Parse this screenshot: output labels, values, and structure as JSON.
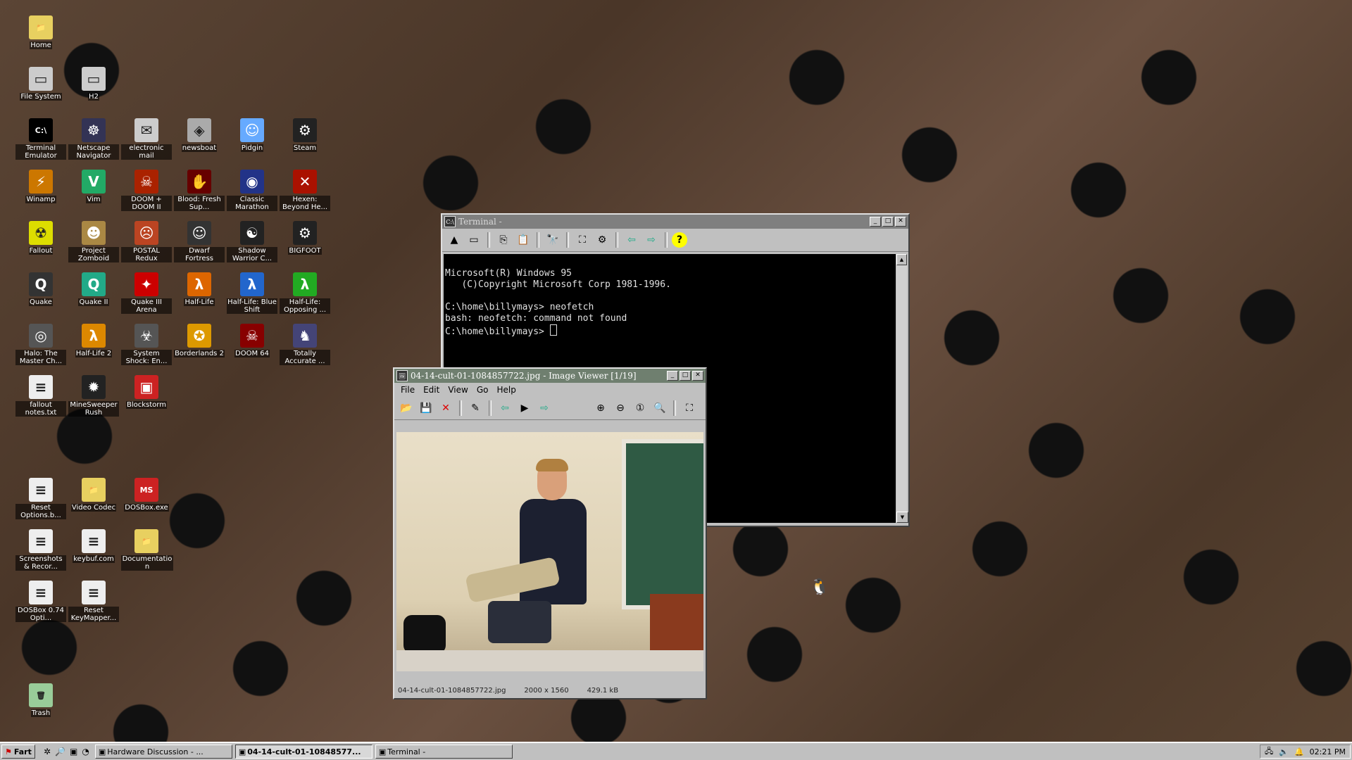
{
  "colors": {
    "accent": "#6f7f6f",
    "terminal_bg": "#000000",
    "window_gray": "#c0c0c0"
  },
  "desktop_icons": [
    {
      "label": "Home",
      "icon": "folder-icon"
    },
    {
      "label": "File System",
      "icon": "drive-icon"
    },
    {
      "label": "H2",
      "icon": "drive-icon"
    },
    {
      "label": "Terminal Emulator",
      "icon": "terminal-icon"
    },
    {
      "label": "Netscape Navigator",
      "icon": "ship-wheel-icon"
    },
    {
      "label": "electronic mail",
      "icon": "mail-icon"
    },
    {
      "label": "newsboat",
      "icon": "news-icon"
    },
    {
      "label": "Pidgin",
      "icon": "pidgin-icon"
    },
    {
      "label": "Steam",
      "icon": "steam-icon"
    },
    {
      "label": "Winamp",
      "icon": "winamp-icon"
    },
    {
      "label": "Vim",
      "icon": "vim-icon"
    },
    {
      "label": "DOOM + DOOM II",
      "icon": "doom-icon"
    },
    {
      "label": "Blood: Fresh Sup...",
      "icon": "blood-icon"
    },
    {
      "label": "Classic Marathon",
      "icon": "marathon-icon"
    },
    {
      "label": "Hexen: Beyond He...",
      "icon": "hexen-icon"
    },
    {
      "label": "Fallout",
      "icon": "radiation-icon"
    },
    {
      "label": "Project Zomboid",
      "icon": "zomboid-icon"
    },
    {
      "label": "POSTAL Redux",
      "icon": "postal-icon"
    },
    {
      "label": "Dwarf Fortress",
      "icon": "dwarf-icon"
    },
    {
      "label": "Shadow Warrior C...",
      "icon": "yin-yang-icon"
    },
    {
      "label": "BIGFOOT",
      "icon": "steam-icon"
    },
    {
      "label": "Quake",
      "icon": "quake-icon"
    },
    {
      "label": "Quake II",
      "icon": "quake2-icon"
    },
    {
      "label": "Quake III Arena",
      "icon": "quake3-icon"
    },
    {
      "label": "Half-Life",
      "icon": "lambda-icon"
    },
    {
      "label": "Half-Life: Blue Shift",
      "icon": "lambda-blue-icon"
    },
    {
      "label": "Half-Life: Opposing ...",
      "icon": "lambda-green-icon"
    },
    {
      "label": "Halo: The Master Ch...",
      "icon": "halo-icon"
    },
    {
      "label": "Half-Life 2",
      "icon": "lambda2-icon"
    },
    {
      "label": "System Shock: En...",
      "icon": "shodan-icon"
    },
    {
      "label": "Borderlands 2",
      "icon": "borderlands-icon"
    },
    {
      "label": "DOOM 64",
      "icon": "doom64-icon"
    },
    {
      "label": "Totally Accurate ...",
      "icon": "tabs-icon"
    },
    {
      "label": "fallout notes.txt",
      "icon": "text-file-icon"
    },
    {
      "label": "MineSweeper Rush",
      "icon": "mine-icon"
    },
    {
      "label": "Blockstorm",
      "icon": "blockstorm-icon"
    },
    {
      "label": "Reset Options.b...",
      "icon": "text-file-icon"
    },
    {
      "label": "Video Codec",
      "icon": "folder-icon"
    },
    {
      "label": "DOSBox.exe",
      "icon": "dosbox-icon"
    },
    {
      "label": "Screenshots & Recor...",
      "icon": "text-file-icon"
    },
    {
      "label": "keybuf.com",
      "icon": "text-file-icon"
    },
    {
      "label": "Documentation",
      "icon": "folder-icon"
    },
    {
      "label": "DOSBox 0.74 Opti...",
      "icon": "text-file-icon"
    },
    {
      "label": "Reset KeyMapper...",
      "icon": "text-file-icon"
    },
    {
      "label": "Trash",
      "icon": "trash-icon"
    }
  ],
  "terminal": {
    "title": "Terminal -",
    "lines": [
      "Microsoft(R) Windows 95",
      "   (C)Copyright Microsoft Corp 1981-1996.",
      "",
      "C:\\home\\billymays> neofetch",
      "bash: neofetch: command not found",
      "C:\\home\\billymays> "
    ]
  },
  "image_viewer": {
    "title": "04-14-cult-01-1084857722.jpg - Image Viewer [1/19]",
    "menu": [
      "File",
      "Edit",
      "View",
      "Go",
      "Help"
    ],
    "status_filename": "04-14-cult-01-1084857722.jpg",
    "status_dimensions": "2000 x 1560",
    "status_size": "429.1 kB"
  },
  "taskbar": {
    "start_label": "Fart",
    "tasks": [
      {
        "label": "Hardware Discussion - ...",
        "pressed": false
      },
      {
        "label": "04-14-cult-01-10848577...",
        "pressed": true
      },
      {
        "label": "Terminal -",
        "pressed": false
      }
    ],
    "clock": "02:21 PM"
  }
}
